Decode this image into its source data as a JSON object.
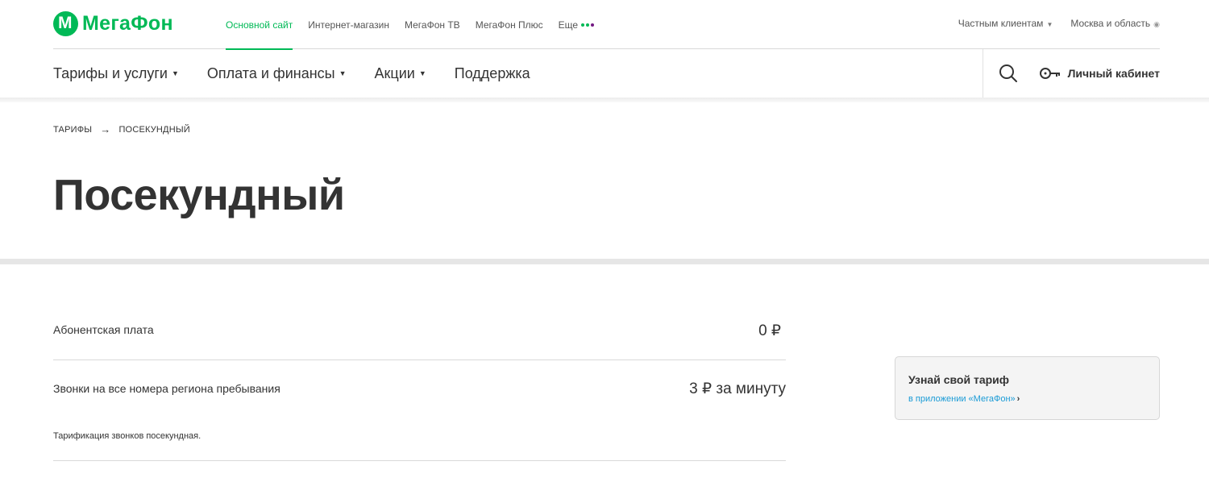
{
  "brand": {
    "logo_text": "МегаФон",
    "logo_glyph": "М",
    "colors": {
      "accent": "#00b956",
      "link": "#1a9bd6",
      "text": "#333333"
    }
  },
  "topnav": {
    "items": [
      {
        "label": "Основной сайт",
        "active": true
      },
      {
        "label": "Интернет-магазин"
      },
      {
        "label": "МегаФон ТВ"
      },
      {
        "label": "МегаФон Плюс"
      },
      {
        "label": "Еще"
      }
    ],
    "dots_colors": [
      "#00b956",
      "#731982",
      "#731982"
    ]
  },
  "topright": {
    "segment_label": "Частным клиентам",
    "region_label": "Москва и область"
  },
  "mainnav": {
    "items": [
      {
        "label": "Тарифы и услуги",
        "has_caret": true
      },
      {
        "label": "Оплата и финансы",
        "has_caret": true
      },
      {
        "label": "Акции",
        "has_caret": true
      },
      {
        "label": "Поддержка",
        "has_caret": false
      }
    ],
    "search_icon": "search-icon",
    "cabinet_label": "Личный кабинет",
    "cabinet_icon": "key-icon"
  },
  "breadcrumb": {
    "items": [
      "ТАРИФЫ",
      "ПОСЕКУНДНЫЙ"
    ],
    "separator": "→"
  },
  "page": {
    "title": "Посекундный"
  },
  "tariff": {
    "rows": [
      {
        "label": "Абонентская плата",
        "value": "0 ₽"
      },
      {
        "label": "Звонки на все номера региона пребывания",
        "value": "3 ₽ за минуту",
        "note": "Тарификация звонков посекундная."
      }
    ]
  },
  "side_card": {
    "title": "Узнай свой тариф",
    "link_text": "в приложении «МегаФон»",
    "chevron": "›"
  }
}
